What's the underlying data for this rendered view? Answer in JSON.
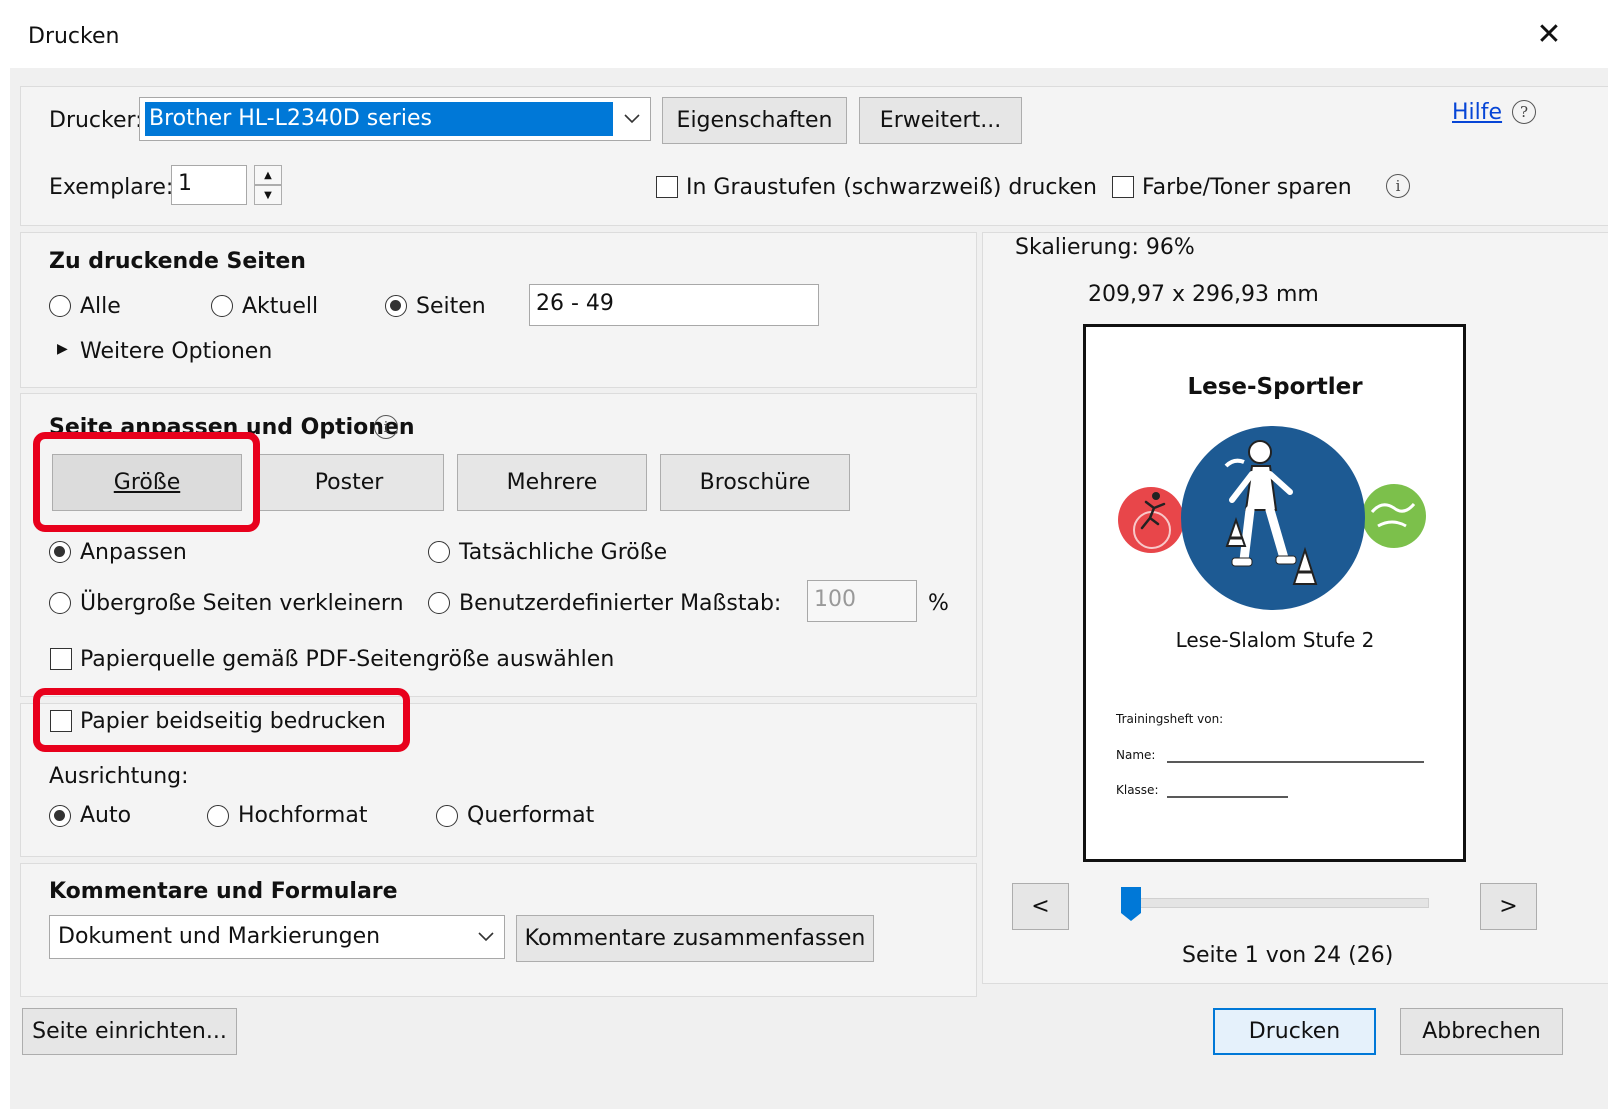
{
  "window": {
    "title": "Drucken",
    "close_glyph": "✕"
  },
  "printer": {
    "label": "Drucker:",
    "selected": "Brother HL-L2340D series",
    "properties_button": "Eigenschaften",
    "advanced_button": "Erweitert...",
    "help_link": "Hilfe",
    "help_icon": "?"
  },
  "copies": {
    "label": "Exemplare:",
    "value": "1"
  },
  "options": {
    "grayscale": "In Graustufen (schwarzweiß) drucken",
    "save_toner": "Farbe/Toner sparen",
    "info_icon": "i"
  },
  "pages_section": {
    "heading": "Zu druckende Seiten",
    "all": "Alle",
    "current": "Aktuell",
    "pages": "Seiten",
    "range": "26 - 49",
    "more_options": "Weitere Optionen"
  },
  "fit_section": {
    "heading": "Seite anpassen und Optionen",
    "tabs": [
      "Größe",
      "Poster",
      "Mehrere",
      "Broschüre"
    ],
    "fit": "Anpassen",
    "actual_size": "Tatsächliche Größe",
    "shrink": "Übergroße Seiten verkleinern",
    "custom_scale": "Benutzerdefinierter Maßstab:",
    "scale_value": "100",
    "percent": "%",
    "paper_source": "Papierquelle gemäß PDF-Seitengröße auswählen"
  },
  "duplex": {
    "label": "Papier beidseitig bedrucken"
  },
  "orientation": {
    "label": "Ausrichtung:",
    "auto": "Auto",
    "portrait": "Hochformat",
    "landscape": "Querformat"
  },
  "comments": {
    "heading": "Kommentare und Formulare",
    "selected": "Dokument und Markierungen",
    "summarize_button": "Kommentare zusammenfassen"
  },
  "preview": {
    "scaling": "Skalierung:  96%",
    "dimensions": "209,97 x 296,93 mm",
    "doc_title": "Lese-Sportler",
    "doc_subtitle": "Lese-Slalom Stufe 2",
    "training_label": "Trainingsheft von:",
    "name_label": "Name:",
    "class_label": "Klasse:",
    "prev": "<",
    "next": ">",
    "page_status": "Seite 1 von 24 (26)",
    "slider_position": 0.0
  },
  "footer": {
    "page_setup": "Seite einrichten...",
    "print": "Drucken",
    "cancel": "Abbrechen"
  },
  "colors": {
    "highlight": "#e8001c",
    "selection": "#0078d7",
    "preview_blue": "#1d5a93",
    "preview_red": "#e8464a",
    "preview_green": "#7cc04b"
  }
}
